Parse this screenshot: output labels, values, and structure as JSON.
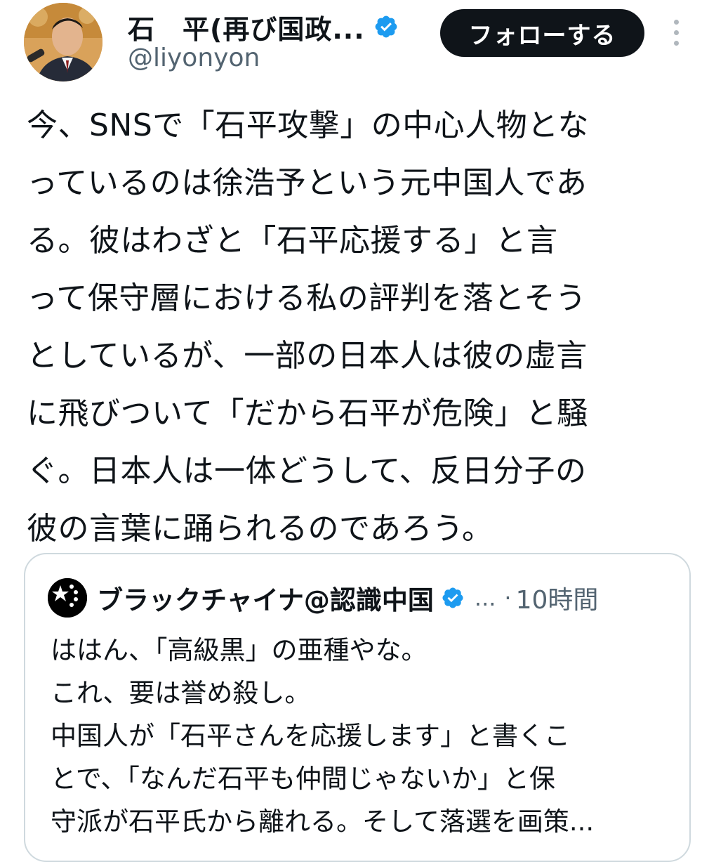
{
  "tweet": {
    "author": {
      "display_name": "石　平(再び国政...",
      "handle": "@liyonyon",
      "verified_icon": "verified-badge-icon",
      "avatar_icon": "profile-photo"
    },
    "follow_label": "フォローする",
    "more_icon": "more-vertical-icon",
    "body_lines": [
      "今、SNSで「石平攻撃」の中心人物とな",
      "っているのは徐浩予という元中国人であ",
      "る。彼はわざと「石平応援する」と言",
      "って保守層における私の評判を落とそう",
      "としているが、一部の日本人は彼の虚言",
      "に飛びついて「だから石平が危険」と騒",
      "ぐ。日本人は一体どうして、反日分子の",
      "彼の言葉に踊られるのであろう。"
    ]
  },
  "quoted": {
    "author_name": "ブラックチャイナ@認識中国",
    "ellipsis": "...",
    "separator": "·",
    "time": "10時間",
    "body_lines": [
      "ははん、「高級黒」の亜種やな。",
      "これ、要は誉め殺し。",
      "中国人が「石平さんを応援します」と書くこ",
      "とで、「なんだ石平も仲間じゃないか」と保",
      "守派が石平氏から離れる。そして落選を画策..."
    ]
  },
  "colors": {
    "verified_blue": "#1d9bf0",
    "text_primary": "#0f1419",
    "text_secondary": "#536471",
    "button_bg": "#0f1419",
    "border": "#cfd9de"
  }
}
